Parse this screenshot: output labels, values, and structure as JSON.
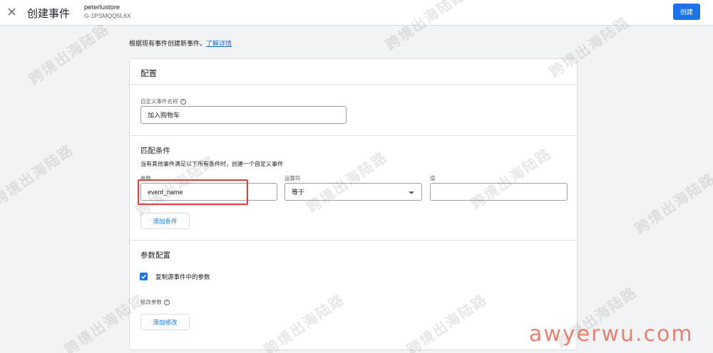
{
  "header": {
    "title": "创建事件",
    "account_name": "peterlustore",
    "account_id": "G-1PSMQQ5L6X",
    "create_label": "创建"
  },
  "intro": {
    "text": "根据现有事件创建新事件。",
    "link": "了解详情"
  },
  "config": {
    "title": "配置",
    "event_name_label": "自定义事件名称",
    "event_name_value": "加入购物车"
  },
  "match": {
    "title": "匹配条件",
    "description": "当有其他事件满足以下所有条件时，创建一个自定义事件",
    "param_label": "参数",
    "operator_label": "运算符",
    "value_label": "值",
    "param_value": "event_name",
    "operator_value": "等于",
    "value_value": "",
    "add_condition_label": "添加条件"
  },
  "params": {
    "title": "参数配置",
    "copy_label": "复制源事件中的参数",
    "copy_checked": true,
    "modify_label": "修改参数",
    "add_modify_label": "添加修改"
  },
  "watermarks": {
    "text": "跨境出海陆路",
    "site": "awyerwu.com"
  },
  "colors": {
    "accent": "#1a73e8",
    "highlight": "#e53935",
    "site_watermark": "#e56c5c"
  }
}
